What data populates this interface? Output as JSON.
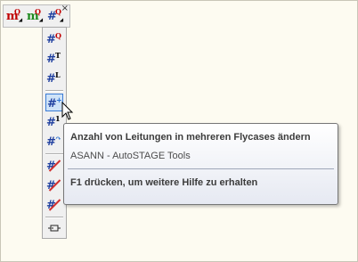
{
  "toolbar": {
    "buttons": [
      {
        "glyph": "m",
        "sup": "Q",
        "color": "#c00000"
      },
      {
        "glyph": "m",
        "sup": "Q",
        "color": "#1e8a1e"
      },
      {
        "glyph": "#",
        "sup": "Q",
        "color": "#1f3f9f"
      }
    ],
    "close": "×"
  },
  "dropdown": {
    "buttons": [
      {
        "glyph": "#",
        "sup": "Q"
      },
      {
        "glyph": "#",
        "sup": "T"
      },
      {
        "glyph": "#",
        "sup": "L"
      },
      {
        "glyph": "#",
        "sup": "+"
      },
      {
        "glyph": "#",
        "sup": "1"
      },
      {
        "glyph": "#",
        "sup": "↷"
      },
      {
        "glyph": "#",
        "sup": ""
      },
      {
        "glyph": "#",
        "sup": ""
      },
      {
        "glyph": "#",
        "sup": ""
      }
    ]
  },
  "tooltip": {
    "title": "Anzahl von Leitungen in mehreren Flycases ändern",
    "subtitle": "ASANN - AutoSTAGE Tools",
    "help": "F1 drücken, um weitere Hilfe zu erhalten"
  },
  "colors": {
    "highlight": "#cfe3f8",
    "hash": "#1f3f9f",
    "red": "#c00000",
    "green": "#1e8a1e"
  }
}
